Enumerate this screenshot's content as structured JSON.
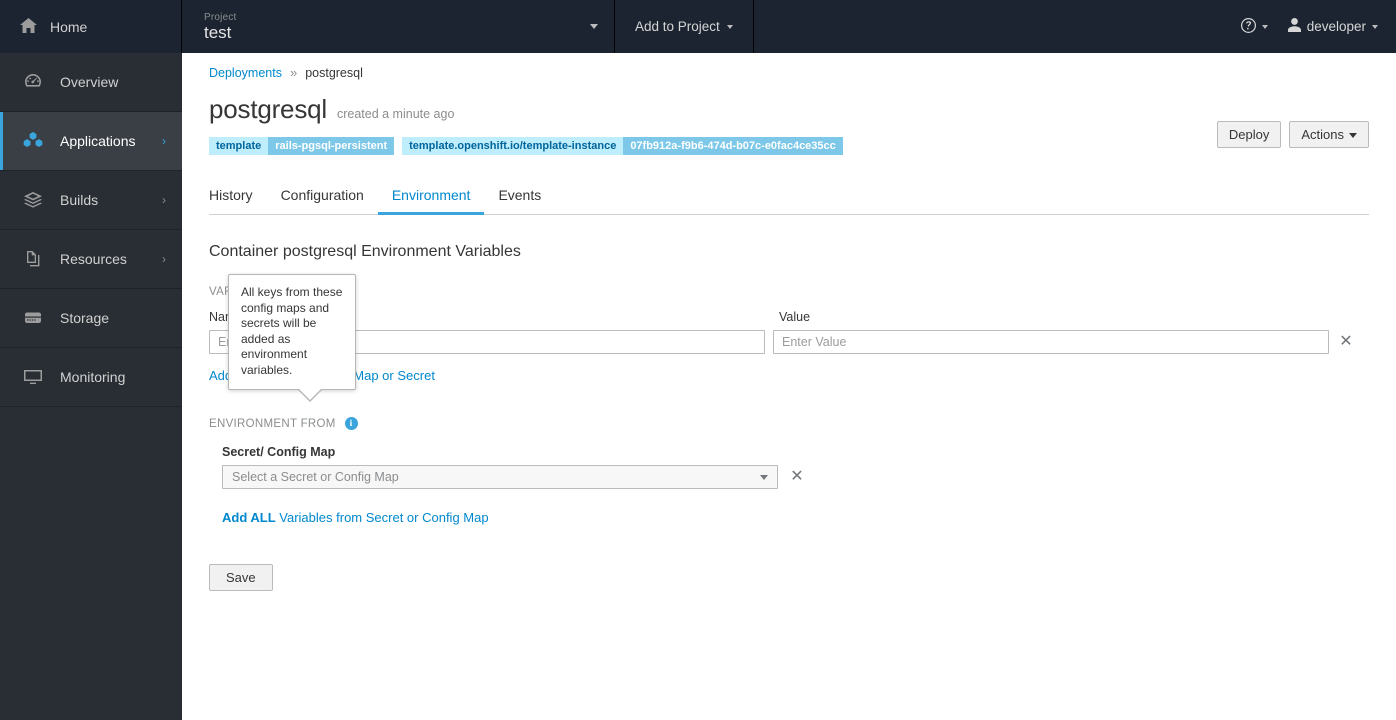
{
  "masthead": {
    "home_label": "Home",
    "home_icon": "home-icon",
    "project_label": "Project",
    "project_name": "test",
    "project_caret_icon": "chevron-down-icon",
    "add_to_project_label": "Add to Project",
    "add_caret_icon": "chevron-down-icon",
    "help_icon": "help-circle-icon",
    "help_caret_icon": "chevron-down-icon",
    "user_icon": "user-icon",
    "user_name": "developer",
    "user_caret_icon": "chevron-down-icon"
  },
  "sidebar": {
    "items": [
      {
        "label": "Overview",
        "icon": "dashboard-icon",
        "active": false,
        "has_chevron": false
      },
      {
        "label": "Applications",
        "icon": "cubes-icon",
        "active": true,
        "has_chevron": true
      },
      {
        "label": "Builds",
        "icon": "layers-icon",
        "active": false,
        "has_chevron": true
      },
      {
        "label": "Resources",
        "icon": "files-icon",
        "active": false,
        "has_chevron": true
      },
      {
        "label": "Storage",
        "icon": "database-icon",
        "active": false,
        "has_chevron": false
      },
      {
        "label": "Monitoring",
        "icon": "monitor-icon",
        "active": false,
        "has_chevron": false
      }
    ],
    "chevron_glyph": "›"
  },
  "breadcrumb": {
    "root": "Deployments",
    "separator": "»",
    "current": "postgresql"
  },
  "page": {
    "title": "postgresql",
    "subtitle": "created a minute ago",
    "deploy_button": "Deploy",
    "actions_button": "Actions",
    "labels": [
      {
        "key": "template",
        "value": "rails-pgsql-persistent"
      },
      {
        "key": "template.openshift.io/template-instance",
        "value": "07fb912a-f9b6-474d-b07c-e0fac4ce35cc"
      }
    ]
  },
  "tabs": [
    {
      "label": "History",
      "active": false
    },
    {
      "label": "Configuration",
      "active": false
    },
    {
      "label": "Environment",
      "active": true
    },
    {
      "label": "Events",
      "active": false
    }
  ],
  "main": {
    "section_heading": "Container postgresql Environment Variables",
    "variables": {
      "section_label": "VARIABLES",
      "col_name": "Name",
      "col_value": "Value",
      "name_placeholder": "Enter Name",
      "name_value": "",
      "value_placeholder": "Enter Value",
      "value_value": "",
      "delete_icon": "close-icon",
      "delete_glyph": "✕",
      "add_link": "Add Value from a Config Map or Secret"
    },
    "environment_from": {
      "section_label": "ENVIRONMENT FROM",
      "info_icon": "info-circle-icon",
      "info_glyph": "i",
      "field_label": "Secret/ Config Map",
      "select_placeholder": "Select a Secret or Config Map",
      "select_caret_icon": "chevron-down-icon",
      "delete_icon": "close-icon",
      "delete_glyph": "✕",
      "add_all_link_bold": "Add ALL",
      "add_all_link_rest": " Variables from Secret or Config Map"
    },
    "save_button": "Save"
  },
  "tooltip": {
    "text": "All keys from these config maps and secrets will be added as environment variables."
  },
  "colors": {
    "masthead_bg": "#1b2430",
    "sidebar_bg": "#292e34",
    "sidebar_active_bg": "#393f44",
    "accent": "#39a5dc",
    "link": "#0088ce",
    "label_key_bg": "#beedfc",
    "label_value_bg": "#7dc8e8"
  }
}
